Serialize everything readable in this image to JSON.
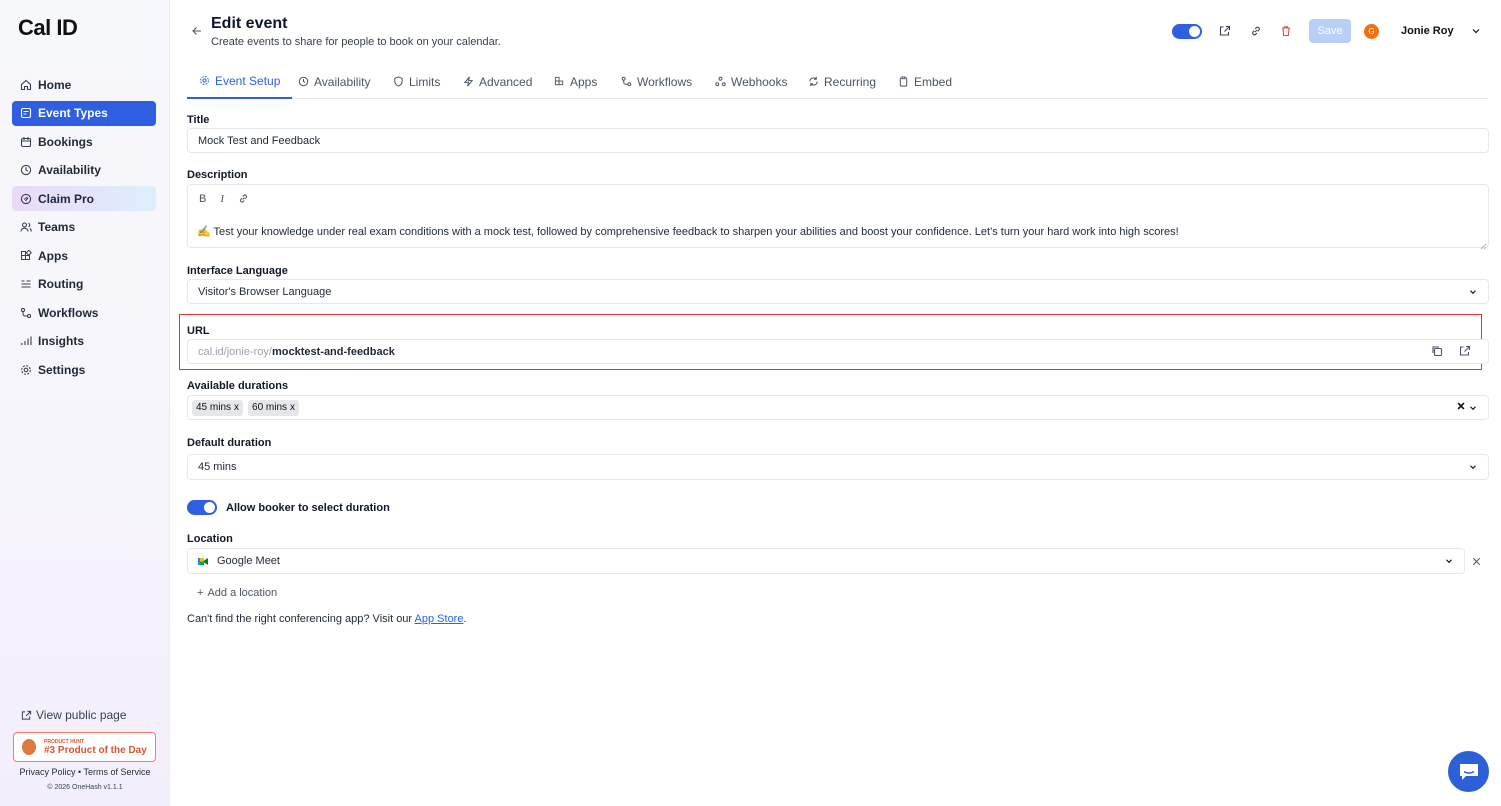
{
  "sidebar": {
    "logo": "Cal ID",
    "items": [
      {
        "label": "Home",
        "icon": "home-icon"
      },
      {
        "label": "Event Types",
        "icon": "event-types-icon",
        "active": true
      },
      {
        "label": "Bookings",
        "icon": "calendar-icon"
      },
      {
        "label": "Availability",
        "icon": "clock-icon"
      },
      {
        "label": "Claim Pro",
        "icon": "badge-icon"
      },
      {
        "label": "Teams",
        "icon": "users-icon"
      },
      {
        "label": "Apps",
        "icon": "apps-icon"
      },
      {
        "label": "Routing",
        "icon": "routing-icon"
      },
      {
        "label": "Workflows",
        "icon": "workflow-icon"
      },
      {
        "label": "Insights",
        "icon": "chart-icon"
      },
      {
        "label": "Settings",
        "icon": "gear-icon"
      }
    ],
    "view_public": "View public page",
    "product_hunt": {
      "small": "PRODUCT HUNT",
      "big": "#3 Product of the Day"
    },
    "footer_links": "Privacy Policy • Terms of Service",
    "copyright": "© 2026 OneHash v1.1.1"
  },
  "header": {
    "title": "Edit event",
    "subtitle": "Create events to share for people to book on your calendar.",
    "save_label": "Save",
    "avatar_letter": "G",
    "user_name": "Jonie Roy"
  },
  "tabs": [
    "Event Setup",
    "Availability",
    "Limits",
    "Advanced",
    "Apps",
    "Workflows",
    "Webhooks",
    "Recurring",
    "Embed"
  ],
  "form": {
    "title_label": "Title",
    "title_value": "Mock Test and Feedback",
    "description_label": "Description",
    "description_value": "✍️ Test your knowledge under real exam conditions with a mock test, followed by comprehensive feedback to sharpen your abilities and boost your confidence. Let's turn your hard work into high scores!",
    "language_label": "Interface Language",
    "language_value": "Visitor's Browser Language",
    "url_label": "URL",
    "url_prefix": "cal.id/jonie-roy/",
    "url_slug": "mocktest-and-feedback",
    "durations_label": "Available durations",
    "durations": [
      "45 mins",
      "60 mins"
    ],
    "default_duration_label": "Default duration",
    "default_duration_value": "45 mins",
    "allow_booker_label": "Allow booker to select duration",
    "location_label": "Location",
    "location_value": "Google Meet",
    "add_location": "Add a location",
    "hint_text": "Can't find the right conferencing app? Visit our ",
    "hint_link": "App Store",
    "hint_end": "."
  },
  "colors": {
    "accent": "#2f5fe0",
    "highlight_border": "#e0323a",
    "delete": "#e5484d"
  }
}
